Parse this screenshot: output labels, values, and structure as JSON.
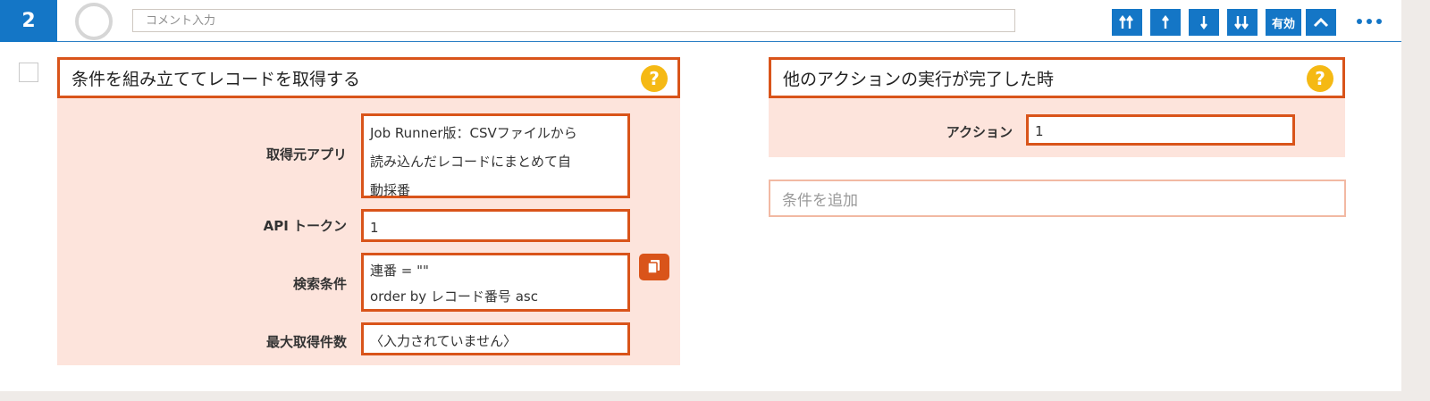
{
  "step": {
    "number": "2"
  },
  "comment": {
    "placeholder": "コメント入力",
    "value": ""
  },
  "toolbar": {
    "move_top_label": "",
    "move_up_label": "",
    "move_down_label": "",
    "move_bottom_label": "",
    "enable_label": "有効",
    "colors": {
      "button": "#1476c6"
    }
  },
  "left_panel": {
    "title": "条件を組み立ててレコードを取得する",
    "help": "?",
    "fields": [
      {
        "label": "取得元アプリ",
        "value": "Job Runner版：CSVファイルから\n読み込んだレコードにまとめて自\n動採番"
      },
      {
        "label": "API トークン",
        "value": "1"
      },
      {
        "label": "検索条件",
        "value": "連番 = \"\"\norder by レコード番号 asc"
      },
      {
        "label": "最大取得件数",
        "value": "〈入力されていません〉"
      }
    ]
  },
  "right_panel": {
    "title": "他のアクションの実行が完了した時",
    "help": "?",
    "action_label": "アクション",
    "action_value": "1",
    "add_condition": "条件を追加"
  },
  "colors": {
    "accent": "#d9541a",
    "panel_bg": "#fde4dc",
    "help": "#f5b914"
  }
}
